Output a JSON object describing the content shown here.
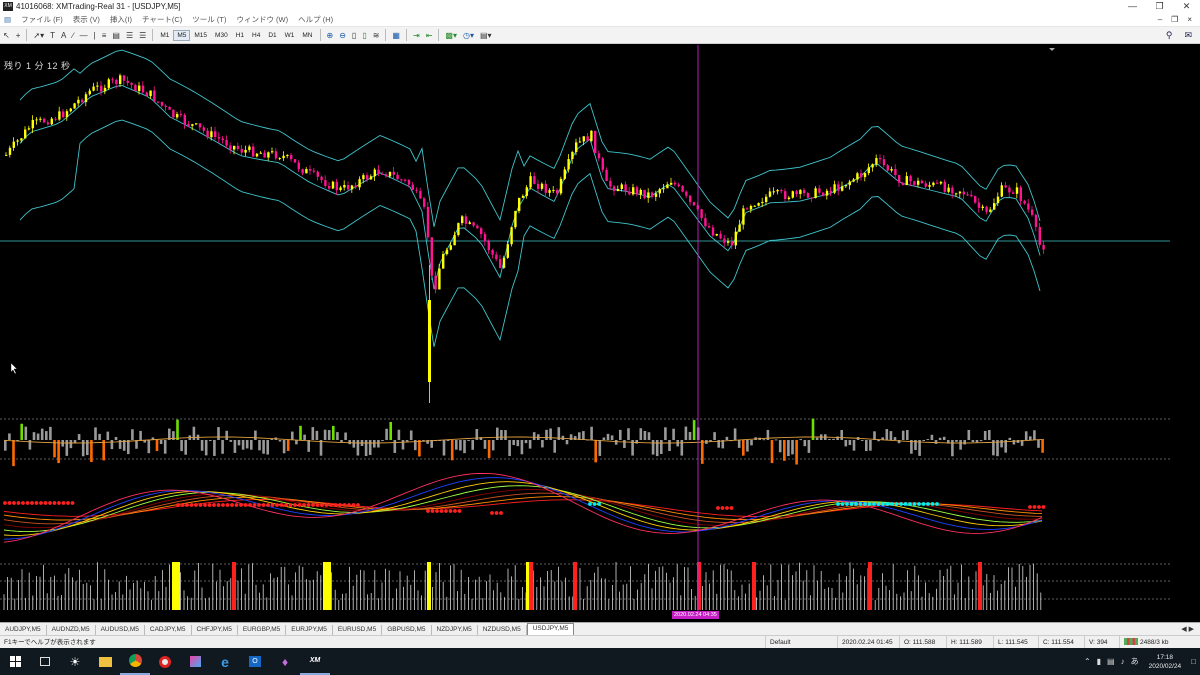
{
  "window": {
    "title": "41016068: XMTrading-Real 31 - [USDJPY,M5]",
    "app_icon": "XM"
  },
  "menu": [
    "ファイル (F)",
    "表示 (V)",
    "挿入(I)",
    "チャート(C)",
    "ツール (T)",
    "ウィンドウ (W)",
    "ヘルプ (H)"
  ],
  "timeframes": [
    "M1",
    "M5",
    "M15",
    "M30",
    "H1",
    "H4",
    "D1",
    "W1",
    "MN"
  ],
  "selected_timeframe": "M5",
  "chart": {
    "symbol": "USDJPY,M5",
    "countdown": "残り 1 分 12 秒",
    "crosshair_time": "2020.02.24 04:35",
    "colors": {
      "bull_candle": "#ffff00",
      "bear_candle": "#ff1493",
      "bollinger": "#3fc4cc",
      "price_line": "#3fc4cc",
      "crosshair": "#d020d0"
    }
  },
  "tabs": [
    "AUDJPY,M5",
    "AUDNZD,M5",
    "AUDUSD,M5",
    "CADJPY,M5",
    "CHFJPY,M5",
    "EURGBP,M5",
    "EURJPY,M5",
    "EURUSD,M5",
    "GBPUSD,M5",
    "NZDJPY,M5",
    "NZDUSD,M5",
    "USDJPY,M5"
  ],
  "active_tab": "USDJPY,M5",
  "status": {
    "help": "F1キーでヘルプが表示されます",
    "profile": "Default",
    "datetime": "2020.02.24 01:45",
    "open": "O: 111.588",
    "high": "H: 111.589",
    "low": "L: 111.545",
    "close": "C: 111.554",
    "volume": "V: 394",
    "traffic": "2488/3 kb"
  },
  "taskbar": {
    "time": "17:18",
    "date": "2020/02/24",
    "ime": "あ",
    "apps": [
      "windows-start",
      "task-view",
      "weather",
      "file-explorer",
      "chrome",
      "app-red",
      "app-paint",
      "edge",
      "outlook",
      "app-gem",
      "xm-terminal"
    ]
  }
}
